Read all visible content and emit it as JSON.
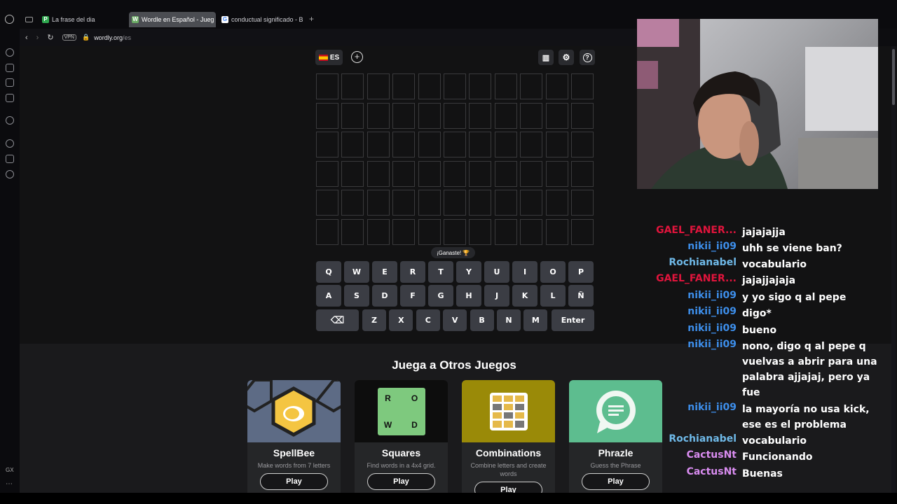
{
  "browser": {
    "tabs": [
      {
        "label": "La frase del dia",
        "favicon": "P",
        "color": "#2fa84f"
      },
      {
        "label": "Wordle en Español - Jueg",
        "favicon": "W",
        "color": "#6aaa64"
      },
      {
        "label": "conductual significado - B",
        "favicon": "G",
        "color": "#ffffff"
      }
    ],
    "url_host": "wordly.org",
    "url_path": "/es",
    "vpn_label": "VPN",
    "gx_label": "GX"
  },
  "game": {
    "language_label": "ES",
    "grid_rows": 6,
    "grid_cols": 11,
    "toast": "¡Ganaste! 🏆",
    "keyboard": {
      "row1": [
        "Q",
        "W",
        "E",
        "R",
        "T",
        "Y",
        "U",
        "I",
        "O",
        "P"
      ],
      "row2": [
        "A",
        "S",
        "D",
        "F",
        "G",
        "H",
        "J",
        "K",
        "L",
        "Ñ"
      ],
      "row3": [
        "Z",
        "X",
        "C",
        "V",
        "B",
        "N",
        "M"
      ],
      "enter": "Enter"
    }
  },
  "more_games": {
    "title": "Juega a Otros Juegos",
    "cards": [
      {
        "title": "SpellBee",
        "desc": "Make words from 7 letters",
        "play": "Play",
        "bg": "#5d6b85"
      },
      {
        "title": "Squares",
        "desc": "Find words in a 4x4 grid.",
        "play": "Play",
        "bg": "#0d0d0d",
        "letters": [
          "R",
          "O",
          "W",
          "D"
        ]
      },
      {
        "title": "Combinations",
        "desc": "Combine letters and create words",
        "play": "Play",
        "bg": "#9a8a08"
      },
      {
        "title": "Phrazle",
        "desc": "Guess the Phrase",
        "play": "Play",
        "bg": "#5dbd8f"
      }
    ]
  },
  "chat": {
    "messages": [
      {
        "user": "GAEL_FANER...",
        "color": "#e0143c",
        "text": "jajajajja"
      },
      {
        "user": "nikii_ii09",
        "color": "#3d8eea",
        "text": "uhh se viene ban?"
      },
      {
        "user": "Rochianabel",
        "color": "#6fb9e8",
        "text": "vocabulario"
      },
      {
        "user": "GAEL_FANER...",
        "color": "#e0143c",
        "text": "jajajjajaja"
      },
      {
        "user": "nikii_ii09",
        "color": "#3d8eea",
        "text": "y yo sigo q al pepe"
      },
      {
        "user": "nikii_ii09",
        "color": "#3d8eea",
        "text": "digo*"
      },
      {
        "user": "nikii_ii09",
        "color": "#3d8eea",
        "text": "bueno"
      },
      {
        "user": "nikii_ii09",
        "color": "#3d8eea",
        "text": "nono, digo q al pepe q vuelvas a abrir para una palabra ajjajaj, pero ya fue"
      },
      {
        "user": "nikii_ii09",
        "color": "#3d8eea",
        "text": "la mayoría no usa kick, ese es el problema"
      },
      {
        "user": "Rochianabel",
        "color": "#6fb9e8",
        "text": "vocabulario"
      },
      {
        "user": "CactusNt",
        "color": "#d98cf0",
        "text": "Funcionando"
      },
      {
        "user": "CactusNt",
        "color": "#d98cf0",
        "text": "Buenas"
      }
    ]
  }
}
